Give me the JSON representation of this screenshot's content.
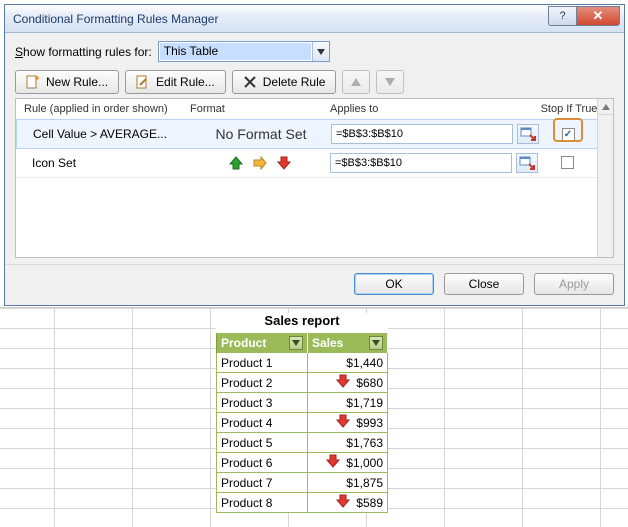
{
  "dialog": {
    "title": "Conditional Formatting Rules Manager",
    "show_label_pre": "S",
    "show_label_post": "how formatting rules for:",
    "scope": "This Table",
    "buttons": {
      "new": "New Rule...",
      "edit": "Edit Rule...",
      "delete": "Delete Rule"
    },
    "columns": {
      "rule": "Rule (applied in order shown)",
      "format": "Format",
      "applies": "Applies to",
      "stop": "Stop If True"
    },
    "rules": [
      {
        "name": "Cell Value > AVERAGE...",
        "format_text": "No Format Set",
        "applies": "=$B$3:$B$10",
        "stop_if_true": true
      },
      {
        "name": "Icon Set",
        "format_icons": [
          "up-green",
          "right-yellow",
          "down-red"
        ],
        "applies": "=$B$3:$B$10",
        "stop_if_true": false
      }
    ],
    "footer": {
      "ok": "OK",
      "close": "Close",
      "apply": "Apply"
    }
  },
  "report": {
    "title": "Sales report",
    "headers": {
      "product": "Product",
      "sales": "Sales"
    },
    "rows": [
      {
        "product": "Product 1",
        "sales": "$1,440",
        "arrow": false
      },
      {
        "product": "Product 2",
        "sales": "$680",
        "arrow": true
      },
      {
        "product": "Product 3",
        "sales": "$1,719",
        "arrow": false
      },
      {
        "product": "Product 4",
        "sales": "$993",
        "arrow": true
      },
      {
        "product": "Product 5",
        "sales": "$1,763",
        "arrow": false
      },
      {
        "product": "Product 6",
        "sales": "$1,000",
        "arrow": true
      },
      {
        "product": "Product 7",
        "sales": "$1,875",
        "arrow": false
      },
      {
        "product": "Product 8",
        "sales": "$589",
        "arrow": true
      }
    ]
  }
}
